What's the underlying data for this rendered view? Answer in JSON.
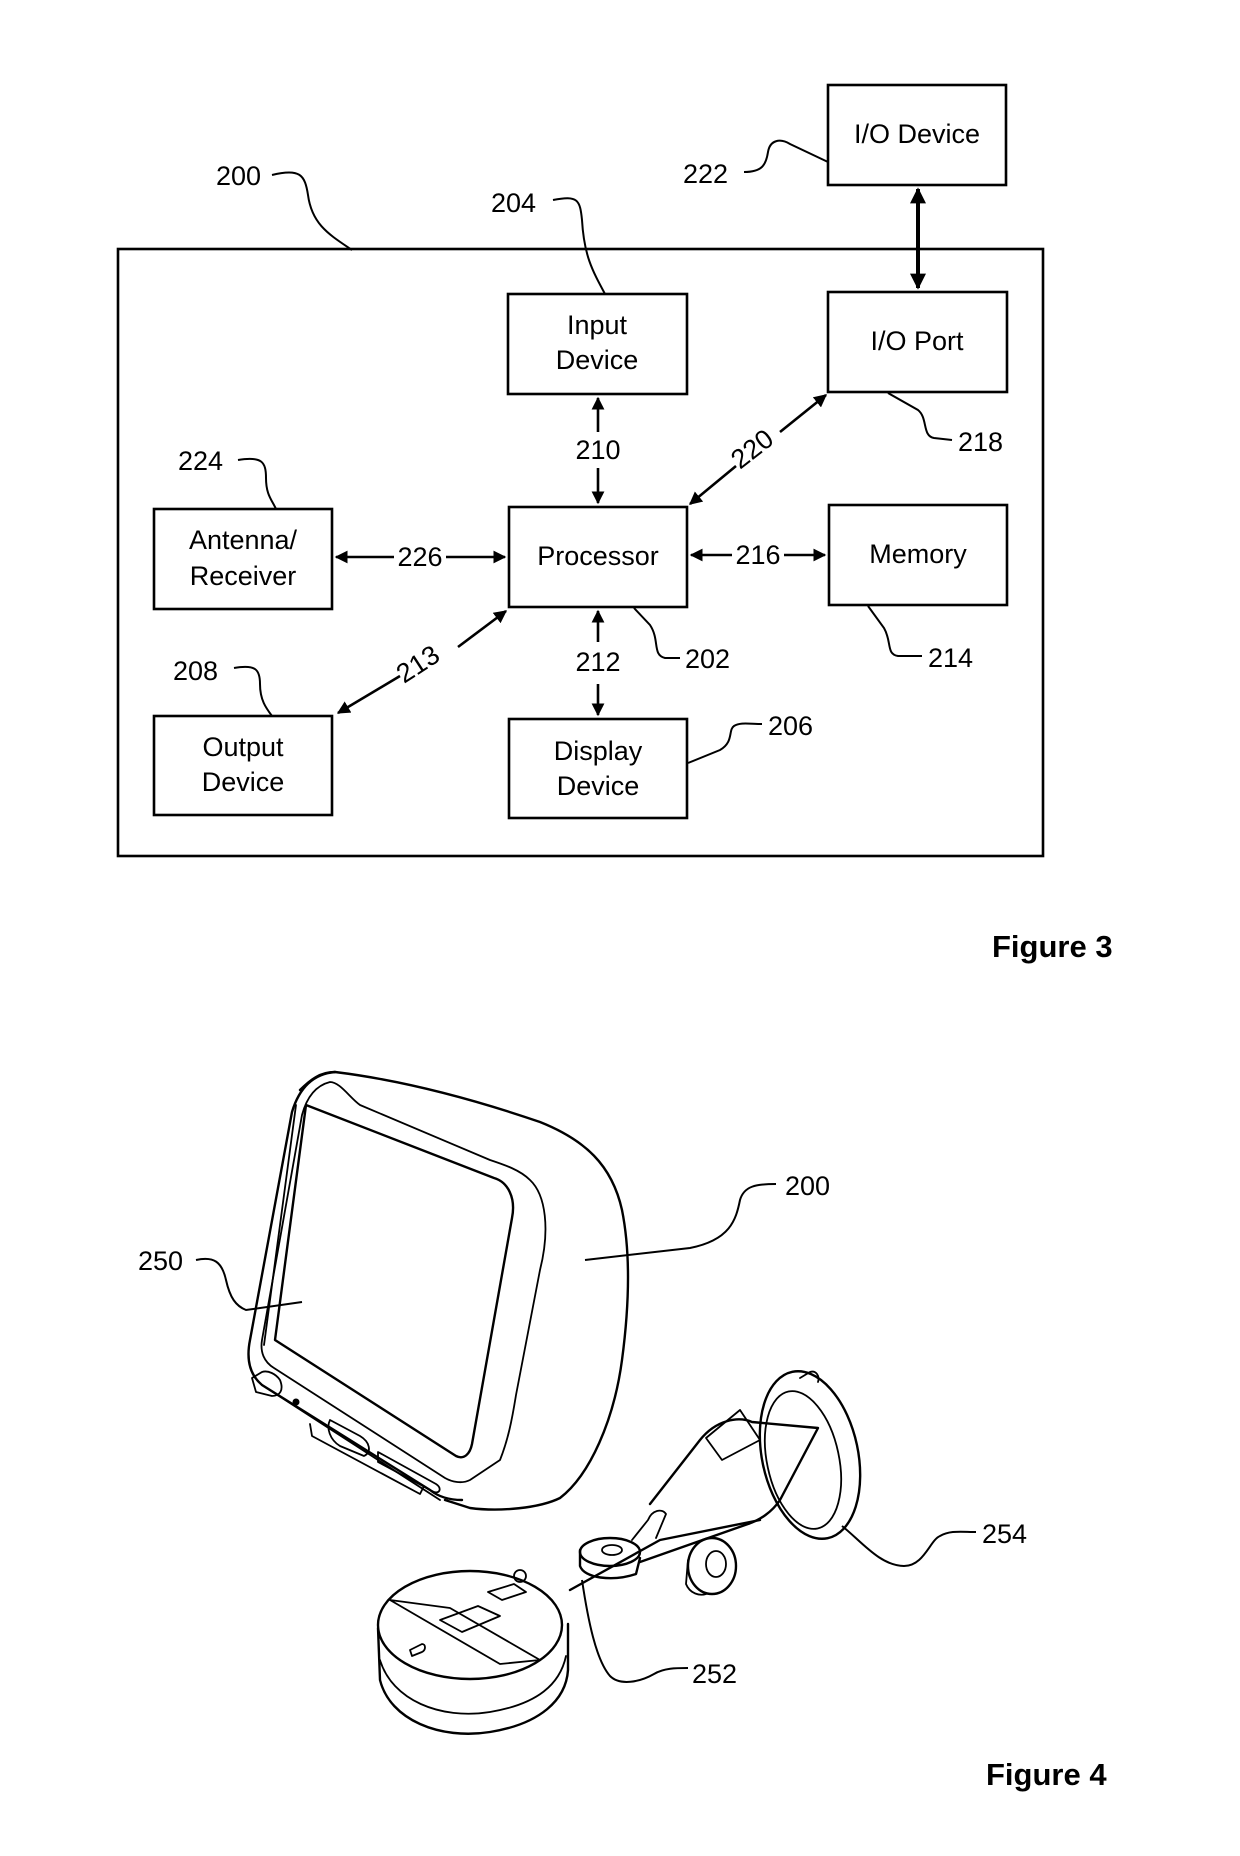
{
  "figure3": {
    "caption": "Figure 3",
    "device_ref": "200",
    "blocks": {
      "io_device": {
        "lines": [
          "I/O Device"
        ],
        "ref": "222"
      },
      "input_device": {
        "lines": [
          "Input",
          "Device"
        ],
        "ref": "204"
      },
      "io_port": {
        "lines": [
          "I/O Port"
        ],
        "ref": "218"
      },
      "antenna": {
        "lines": [
          "Antenna/",
          "Receiver"
        ],
        "ref": "224"
      },
      "processor": {
        "lines": [
          "Processor"
        ],
        "ref": "202"
      },
      "memory": {
        "lines": [
          "Memory"
        ],
        "ref": "214"
      },
      "output_device": {
        "lines": [
          "Output",
          "Device"
        ],
        "ref": "208"
      },
      "display_device": {
        "lines": [
          "Display",
          "Device"
        ],
        "ref": "206"
      }
    },
    "connections": {
      "input_processor": "210",
      "ioport_processor": "220",
      "antenna_processor": "226",
      "processor_memory": "216",
      "processor_output": "213",
      "processor_display": "212"
    }
  },
  "figure4": {
    "caption": "Figure 4",
    "refs": {
      "device": "200",
      "screen": "250",
      "arm": "252",
      "suction_cup": "254"
    }
  }
}
